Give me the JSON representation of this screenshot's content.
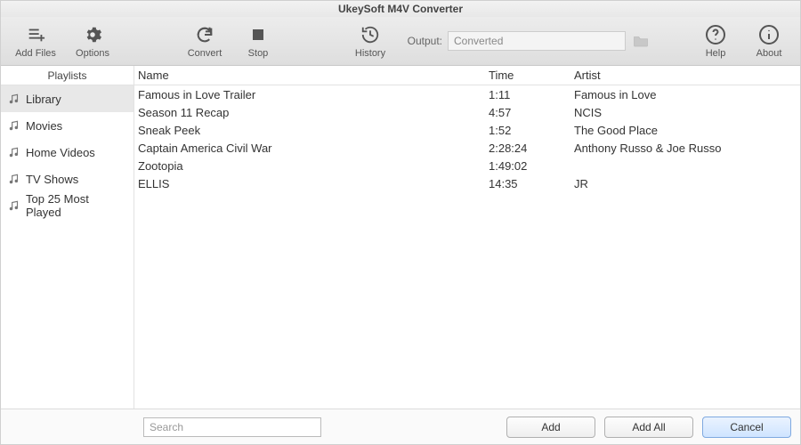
{
  "app": {
    "title": "UkeySoft M4V Converter"
  },
  "toolbar": {
    "add_files": "Add Files",
    "options": "Options",
    "convert": "Convert",
    "stop": "Stop",
    "history": "History",
    "output_label": "Output:",
    "output_value": "Converted",
    "help": "Help",
    "about": "About"
  },
  "sidebar": {
    "header": "Playlists",
    "items": [
      {
        "label": "Library",
        "selected": true
      },
      {
        "label": "Movies",
        "selected": false
      },
      {
        "label": "Home Videos",
        "selected": false
      },
      {
        "label": "TV Shows",
        "selected": false
      },
      {
        "label": "Top 25 Most Played",
        "selected": false
      }
    ]
  },
  "columns": {
    "name": "Name",
    "time": "Time",
    "artist": "Artist"
  },
  "rows": [
    {
      "name": "Famous in Love  Trailer",
      "time": "1:11",
      "artist": "Famous in Love"
    },
    {
      "name": "Season 11 Recap",
      "time": "4:57",
      "artist": "NCIS"
    },
    {
      "name": "Sneak Peek",
      "time": "1:52",
      "artist": "The Good Place"
    },
    {
      "name": "Captain America  Civil War",
      "time": "2:28:24",
      "artist": "Anthony Russo & Joe Russo"
    },
    {
      "name": "Zootopia",
      "time": "1:49:02",
      "artist": ""
    },
    {
      "name": "ELLIS",
      "time": "14:35",
      "artist": "JR"
    }
  ],
  "footer": {
    "search_placeholder": "Search",
    "add": "Add",
    "add_all": "Add All",
    "cancel": "Cancel"
  }
}
